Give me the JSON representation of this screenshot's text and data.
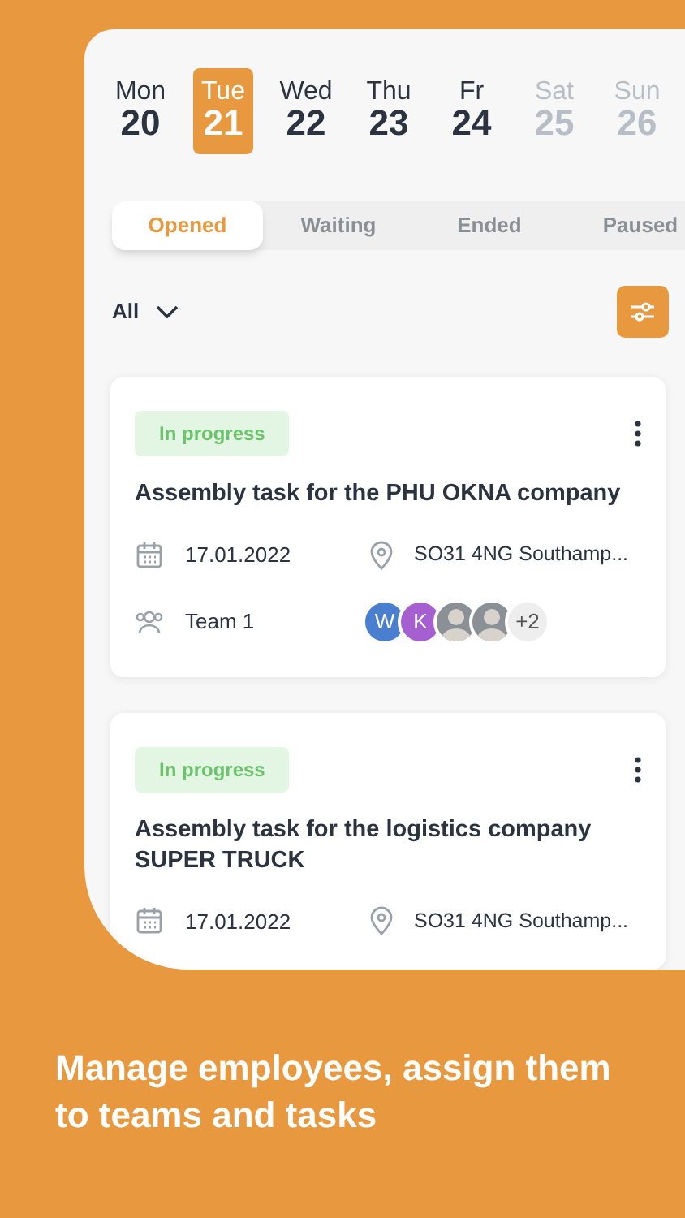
{
  "days": [
    {
      "weekday": "Mon",
      "day": "20",
      "selected": false,
      "disabled": false
    },
    {
      "weekday": "Tue",
      "day": "21",
      "selected": true,
      "disabled": false
    },
    {
      "weekday": "Wed",
      "day": "22",
      "selected": false,
      "disabled": false
    },
    {
      "weekday": "Thu",
      "day": "23",
      "selected": false,
      "disabled": false
    },
    {
      "weekday": "Fr",
      "day": "24",
      "selected": false,
      "disabled": false
    },
    {
      "weekday": "Sat",
      "day": "25",
      "selected": false,
      "disabled": true
    },
    {
      "weekday": "Sun",
      "day": "26",
      "selected": false,
      "disabled": true
    }
  ],
  "tabs": [
    {
      "label": "Opened",
      "selected": true
    },
    {
      "label": "Waiting",
      "selected": false
    },
    {
      "label": "Ended",
      "selected": false
    },
    {
      "label": "Paused",
      "selected": false
    }
  ],
  "filter": {
    "value": "All"
  },
  "tasks": [
    {
      "status": "In progress",
      "title": "Assembly task for the PHU OKNA company",
      "date": "17.01.2022",
      "address": "SO31 4NG Southamp...",
      "team": "Team 1",
      "members": [
        {
          "kind": "initial",
          "text": "W",
          "color": "#4a7fd0"
        },
        {
          "kind": "initial",
          "text": "K",
          "color": "#a55fd0"
        },
        {
          "kind": "photo"
        },
        {
          "kind": "photo"
        },
        {
          "kind": "more",
          "text": "+2"
        }
      ]
    },
    {
      "status": "In progress",
      "title": "Assembly task for the logistics company SUPER TRUCK",
      "date": "17.01.2022",
      "address": "SO31 4NG Southamp..."
    }
  ],
  "caption": "Manage employees, assign them to teams and tasks"
}
